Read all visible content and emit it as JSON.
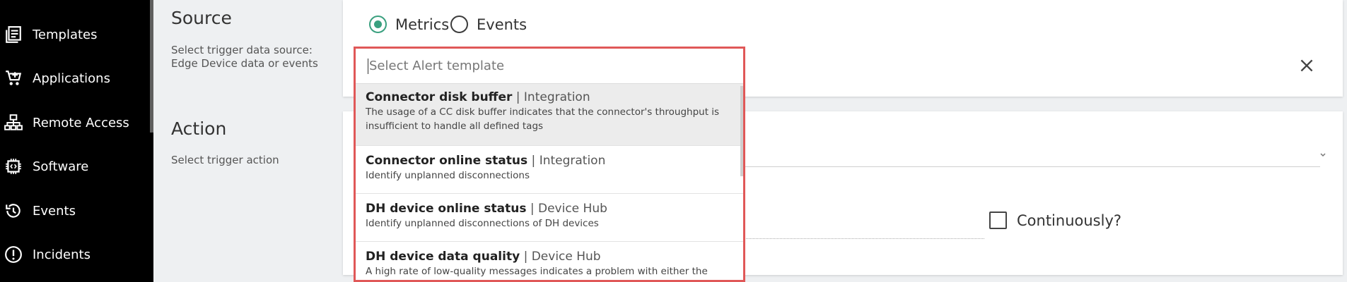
{
  "sidebar": {
    "items": [
      {
        "label": "Templates",
        "icon": "templates-icon"
      },
      {
        "label": "Applications",
        "icon": "cart-icon"
      },
      {
        "label": "Remote Access",
        "icon": "network-icon"
      },
      {
        "label": "Software",
        "icon": "chip-icon"
      },
      {
        "label": "Events",
        "icon": "history-icon"
      },
      {
        "label": "Incidents",
        "icon": "alert-circle-icon"
      }
    ]
  },
  "source": {
    "title": "Source",
    "description_line1": "Select trigger data source:",
    "description_line2": "Edge Device data or events",
    "radio_metrics": "Metrics",
    "radio_events": "Events",
    "selected": "Metrics"
  },
  "action": {
    "title": "Action",
    "description": "Select trigger action",
    "continuously_label": "Continuously?",
    "continuously_checked": false
  },
  "dropdown": {
    "placeholder": "Select Alert template",
    "value": "",
    "items": [
      {
        "name": "Connector disk buffer",
        "category": "Integration",
        "desc": "The usage of a CC disk buffer indicates that the connector's throughput is insufficient to handle all defined tags"
      },
      {
        "name": "Connector online status",
        "category": "Integration",
        "desc": "Identify unplanned disconnections"
      },
      {
        "name": "DH device online status",
        "category": "Device Hub",
        "desc": "Identify unplanned disconnections of DH devices"
      },
      {
        "name": "DH device data quality",
        "category": "Device Hub",
        "desc": "A high rate of low-quality messages indicates a problem with either the"
      }
    ]
  },
  "colors": {
    "accent_green": "#3aa07f",
    "highlight_border": "#e05858",
    "sidebar_bg": "#000000"
  }
}
